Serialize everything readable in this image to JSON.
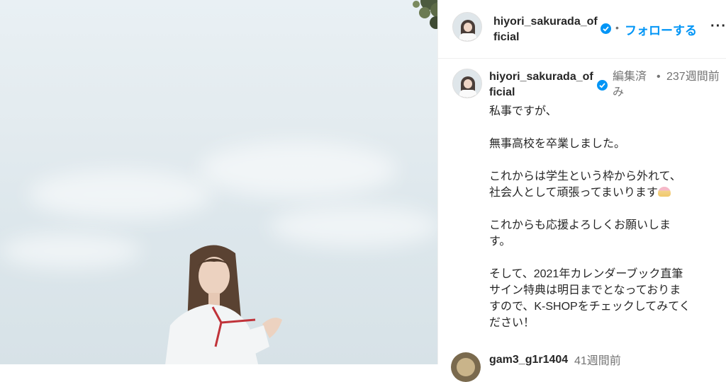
{
  "post_header": {
    "username": "hiyori_sakurada_official",
    "separator": "•",
    "follow_label": "フォローする",
    "more_label": "···"
  },
  "caption_block": {
    "username": "hiyori_sakurada_official",
    "edited_label": "編集済み",
    "separator": "•",
    "timestamp": "237週間前",
    "paragraphs": [
      "私事ですが、",
      "無事高校を卒業しました。",
      "これからは学生という枠から外れて、\n社会人として頑張ってまいります",
      "これからも応援よろしくお願いしま\nす。",
      "そして、2021年カレンダーブック直筆\nサイン特典は明日までとなっておりま\nすので、K-SHOPをチェックしてみてく\nださい！"
    ],
    "emoji_icon": "shaved-ice-icon"
  },
  "comment": {
    "username": "gam3_g1r1404",
    "timestamp": "41週間前"
  },
  "colors": {
    "accent": "#0095f6",
    "text": "#262626",
    "secondary": "#737373",
    "divider": "#efefef"
  }
}
